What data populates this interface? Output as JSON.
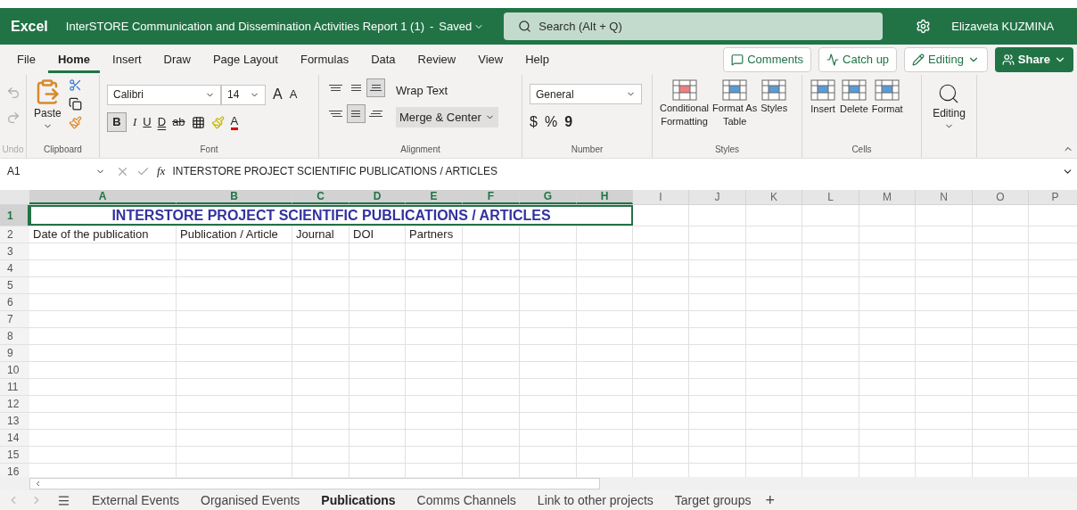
{
  "title_bar": {
    "app_name": "Excel",
    "document_title": "InterSTORE Communication and Dissemination Activities Report 1 (1)",
    "separator": "-",
    "save_status": "Saved",
    "search_placeholder": "Search (Alt + Q)",
    "user_name": "Elizaveta KUZMINA"
  },
  "menu_tabs": [
    {
      "label": "File",
      "selected": false
    },
    {
      "label": "Home",
      "selected": true
    },
    {
      "label": "Insert",
      "selected": false
    },
    {
      "label": "Draw",
      "selected": false
    },
    {
      "label": "Page Layout",
      "selected": false
    },
    {
      "label": "Formulas",
      "selected": false
    },
    {
      "label": "Data",
      "selected": false
    },
    {
      "label": "Review",
      "selected": false
    },
    {
      "label": "View",
      "selected": false
    },
    {
      "label": "Help",
      "selected": false
    }
  ],
  "actions": {
    "comments": "Comments",
    "catch_up": "Catch up",
    "mode": "Editing",
    "share": "Share"
  },
  "ribbon": {
    "undo_group": "Undo",
    "clipboard": {
      "paste": "Paste",
      "label": "Clipboard"
    },
    "font": {
      "name": "Calibri",
      "size": "14",
      "grow": "A",
      "shrink": "A",
      "font_color_letter": "A",
      "bold_on": true,
      "bold": "B",
      "italic": "I",
      "underline": "U",
      "double_underline": "D",
      "strike": "ab",
      "label": "Font"
    },
    "alignment": {
      "buttons": [
        {
          "kind": "top",
          "selected": false
        },
        {
          "kind": "middle",
          "selected": false
        },
        {
          "kind": "bottom",
          "selected": true
        },
        {
          "kind": "left",
          "selected": false
        },
        {
          "kind": "center",
          "selected": true
        },
        {
          "kind": "right",
          "selected": false
        }
      ],
      "wrap_text": "Wrap Text",
      "merge_center": "Merge & Center",
      "merge_on": true,
      "label": "Alignment"
    },
    "number": {
      "format": "General",
      "currency": "$",
      "percent": "%",
      "comma": "9",
      "label": "Number"
    },
    "styles": {
      "conditional": [
        "Conditional",
        "Formatting"
      ],
      "format_table": [
        "Format As",
        "Table"
      ],
      "styles": "Styles",
      "label": "Styles"
    },
    "cells": {
      "insert": "Insert",
      "delete": "Delete",
      "format": "Format",
      "label": "Cells"
    },
    "editing": "Editing"
  },
  "formula_bar": {
    "cell_ref": "A1",
    "fx": "fx",
    "content": "INTERSTORE PROJECT SCIENTIFIC PUBLICATIONS / ARTICLES"
  },
  "columns": [
    {
      "label": "A",
      "selected": true
    },
    {
      "label": "B",
      "selected": true
    },
    {
      "label": "C",
      "selected": true
    },
    {
      "label": "D",
      "selected": true
    },
    {
      "label": "E",
      "selected": true
    },
    {
      "label": "F",
      "selected": true
    },
    {
      "label": "G",
      "selected": true
    },
    {
      "label": "H",
      "selected": true
    },
    {
      "label": "I",
      "selected": false
    },
    {
      "label": "J",
      "selected": false
    },
    {
      "label": "K",
      "selected": false
    },
    {
      "label": "L",
      "selected": false
    },
    {
      "label": "M",
      "selected": false
    },
    {
      "label": "N",
      "selected": false
    },
    {
      "label": "O",
      "selected": false
    },
    {
      "label": "P",
      "selected": false
    }
  ],
  "rows": [
    {
      "number": "1",
      "selected": true,
      "title": "INTERSTORE PROJECT SCIENTIFIC PUBLICATIONS / ARTICLES"
    },
    {
      "number": "2",
      "selected": false,
      "cells": [
        "Date of the publication",
        "Publication / Article",
        "Journal",
        "DOI",
        "Partners"
      ]
    },
    {
      "number": "3",
      "selected": false
    },
    {
      "number": "4",
      "selected": false
    },
    {
      "number": "5",
      "selected": false
    },
    {
      "number": "6",
      "selected": false
    },
    {
      "number": "7",
      "selected": false
    },
    {
      "number": "8",
      "selected": false
    },
    {
      "number": "9",
      "selected": false
    },
    {
      "number": "10",
      "selected": false
    },
    {
      "number": "11",
      "selected": false
    },
    {
      "number": "12",
      "selected": false
    },
    {
      "number": "13",
      "selected": false
    },
    {
      "number": "14",
      "selected": false
    },
    {
      "number": "15",
      "selected": false
    },
    {
      "number": "16",
      "selected": false
    }
  ],
  "sheet_tabs": [
    {
      "label": "External Events",
      "selected": false
    },
    {
      "label": "Organised Events",
      "selected": false
    },
    {
      "label": "Publications",
      "selected": true
    },
    {
      "label": "Comms Channels",
      "selected": false
    },
    {
      "label": "Link to other projects",
      "selected": false
    },
    {
      "label": "Target groups",
      "selected": false
    }
  ],
  "add_sheet": "+"
}
